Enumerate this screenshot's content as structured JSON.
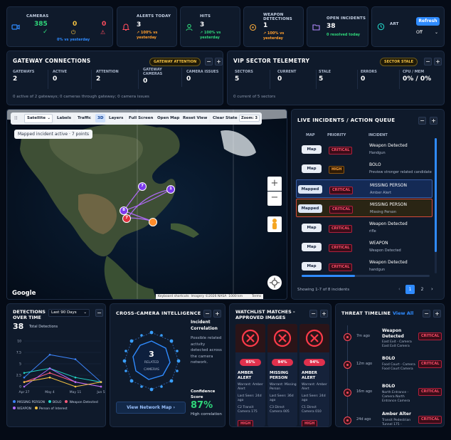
{
  "colors": {
    "accent": "#2f8bff",
    "green": "#2fd67a",
    "yellow": "#f6c343",
    "red": "#ff4d5e",
    "orange": "#ff9f2e",
    "bg": "#050b16",
    "card": "#0f1a2b"
  },
  "top": {
    "cameras": {
      "label": "CAMERAS",
      "online": "385",
      "warning": "0",
      "error": "0",
      "delta": "0% vs yesterday"
    },
    "alerts": {
      "label": "ALERTS TODAY",
      "value": "3",
      "delta": "↗ 100% vs yesterday"
    },
    "hits": {
      "label": "HITS",
      "value": "3",
      "delta": "↗ 100% vs yesterday"
    },
    "weapon": {
      "label": "WEAPON DETECTIONS",
      "value": "1",
      "delta": "↗ 100% vs yesterday"
    },
    "incidents": {
      "label": "OPEN INCIDENTS",
      "value": "38",
      "delta": "0 resolved today"
    },
    "art": {
      "label": "ART"
    },
    "refresh": {
      "button": "Refresh",
      "select": "Off"
    }
  },
  "gateway": {
    "title": "GATEWAY CONNECTIONS",
    "badge": "GATEWAY ATTENTION",
    "stats": [
      {
        "k": "GATEWAYS",
        "v": "2"
      },
      {
        "k": "ACTIVE",
        "v": "0"
      },
      {
        "k": "ATTENTION",
        "v": "2"
      },
      {
        "k": "GATEWAY CAMERAS",
        "v": "0"
      },
      {
        "k": "CAMERA ISSUES",
        "v": "0"
      }
    ],
    "footer": "0 active of 2 gateways; 0 cameras through gateway; 0 camera issues"
  },
  "vip": {
    "title": "VIP SECTOR TELEMETRY",
    "badge": "SECTOR STALE",
    "stats": [
      {
        "k": "SECTORS",
        "v": "5"
      },
      {
        "k": "CURRENT",
        "v": "0"
      },
      {
        "k": "STALE",
        "v": "5"
      },
      {
        "k": "ERRORS",
        "v": "0"
      },
      {
        "k": "CPU / MEM",
        "v": "0% / 0%"
      }
    ],
    "footer": "0 current of 5 sectors"
  },
  "map": {
    "toolbar": {
      "mode": "Satellite",
      "labels": "Labels",
      "traffic": "Traffic",
      "three_d": "3D",
      "layers": "Layers",
      "fullscreen": "Full Screen",
      "open_map": "Open Map",
      "reset": "Reset View",
      "clear": "Clear State",
      "zoom": "Zoom: 3"
    },
    "notice": "Mapped incident active · 7 points",
    "markers": [
      "7",
      "1",
      "8",
      "7"
    ],
    "attribution": {
      "shortcuts": "Keyboard shortcuts",
      "imagery": "Imagery ©2026 NASA",
      "scale": "1000 km",
      "terms": "Terms"
    },
    "logo": "Google"
  },
  "incidents": {
    "title": "LIVE INCIDENTS / ACTION QUEUE",
    "headers": [
      "MAP",
      "PRIORITY",
      "INCIDENT"
    ],
    "rows": [
      {
        "btn": "Map",
        "pri": "CRITICAL",
        "t": "Weapon Detected",
        "s": "Handgun"
      },
      {
        "btn": "Map",
        "pri": "HIGH",
        "t": "BOLO",
        "s": "Preview stronger related candidate"
      },
      {
        "btn": "Mapped",
        "pri": "CRITICAL",
        "t": "MISSING PERSON",
        "s": "Amber Alert"
      },
      {
        "btn": "Mapped",
        "pri": "CRITICAL",
        "t": "MISSING PERSON",
        "s": "Missing Person"
      },
      {
        "btn": "Map",
        "pri": "CRITICAL",
        "t": "Weapon Detected",
        "s": "rifle"
      },
      {
        "btn": "Map",
        "pri": "CRITICAL",
        "t": "WEAPON",
        "s": "Weapon Detected"
      },
      {
        "btn": "Map",
        "pri": "CRITICAL",
        "t": "Weapon Detected",
        "s": "handgun"
      }
    ],
    "showing": "Showing 1-7 of 8 incidents",
    "pages": [
      "1",
      "2"
    ]
  },
  "detections": {
    "title": "DETECTIONS OVER TIME",
    "range": "Last 90 Days",
    "total": "38",
    "total_label": "Total Detections"
  },
  "chart_data": {
    "type": "line",
    "x": [
      "Apr 27",
      "May 4",
      "May 11",
      "Jun 5"
    ],
    "ylim": [
      0,
      10
    ],
    "yticks": [
      "0",
      "2.5",
      "5",
      "7.5",
      "10"
    ],
    "series": [
      {
        "name": "MISSING PERSON",
        "color": "#3b82f6",
        "values": [
          2,
          7,
          6,
          1
        ]
      },
      {
        "name": "BOLO",
        "color": "#22d3c5",
        "values": [
          3,
          4,
          2,
          1
        ]
      },
      {
        "name": "Weapon Detected",
        "color": "#ff5c7a",
        "values": [
          1,
          3,
          1,
          0
        ]
      },
      {
        "name": "WEAPON",
        "color": "#b36bff",
        "values": [
          0,
          4,
          1,
          0
        ]
      },
      {
        "name": "Person of Interest",
        "color": "#f6c343",
        "values": [
          1,
          2,
          0,
          1
        ]
      }
    ]
  },
  "cross": {
    "title": "CROSS-CAMERA INTELLIGENCE",
    "count": "3",
    "count_label1": "RELATED",
    "count_label2": "CAMERAS",
    "corr_title": "Incident Correlation",
    "corr_text": "Possible related activity detected across the camera network.",
    "score_label": "Confidence Score",
    "score": "87%",
    "score_desc": "High correlation",
    "btn": "View Network Map ›"
  },
  "watchlist": {
    "title": "WATCHLIST MATCHES - APPROVED IMAGES",
    "items": [
      {
        "pct": "95%",
        "name": "AMBER ALERT",
        "w": "Warrant: Amber Alert",
        "seen": "Last Seen: 24d ago",
        "cam": "C2 Transit Camera 175",
        "pri": "HIGH"
      },
      {
        "pct": "94%",
        "name": "MISSING PERSON",
        "w": "Warrant: Missing Person",
        "seen": "Last Seen: 36d ago",
        "cam": "C3 Direct Camera 005",
        "pri": ""
      },
      {
        "pct": "94%",
        "name": "AMBER ALERT",
        "w": "Warrant: Amber Alert",
        "seen": "Last Seen: 24d ago",
        "cam": "C1 Direct Camera 010",
        "pri": "HIGH"
      }
    ]
  },
  "timeline": {
    "title": "THREAT TIMELINE",
    "view_all": "View All",
    "items": [
      {
        "time": "7m ago",
        "t": "Weapon Detected",
        "s": "East Exit - Camera East Exit Camera",
        "pri": "CRITICAL"
      },
      {
        "time": "12m ago",
        "t": "BOLO",
        "s": "Food Court - Camera Food Court Camera",
        "pri": "CRITICAL"
      },
      {
        "time": "16m ago",
        "t": "BOLO",
        "s": "North Entrance - Camera North Entrance Camera",
        "pri": "CRITICAL"
      },
      {
        "time": "24d ago",
        "t": "Amber Alter",
        "s": "Transit Pedestrian Tunnel 175 -",
        "pri": "CRITICAL"
      }
    ]
  }
}
